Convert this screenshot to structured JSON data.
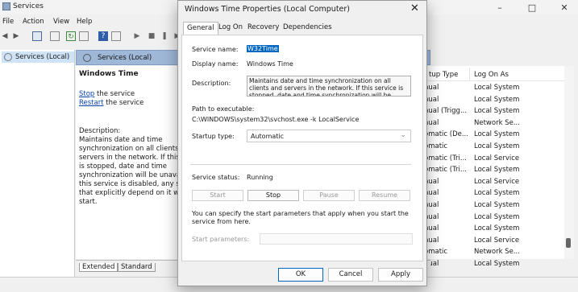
{
  "main": {
    "title": "Services",
    "menu": [
      "File",
      "Action",
      "View",
      "Help"
    ],
    "tree_item": "Services (Local)",
    "panel_header": "Services (Local)",
    "service_heading": "Windows Time",
    "stop_link": "Stop",
    "stop_suffix": " the service",
    "restart_link": "Restart",
    "restart_suffix": " the service",
    "description_label": "Description:",
    "description_lines": [
      "Maintains date and time",
      "synchronization on all clients a",
      "servers in the network. If this s",
      "is stopped, date and time",
      "synchronization will be unavai",
      "this service is disabled, any ser",
      "that explicitly depend on it wil",
      "start."
    ],
    "columns": {
      "startup_type": "tup Type",
      "log_on_as": "Log On As"
    },
    "rows": [
      [
        "nual",
        "Local System"
      ],
      [
        "nual",
        "Local System"
      ],
      [
        "nual (Trigg...",
        "Local System"
      ],
      [
        "nual",
        "Network Se..."
      ],
      [
        "omatic (De...",
        "Local System"
      ],
      [
        "omatic",
        "Local System"
      ],
      [
        "omatic (Tri...",
        "Local Service"
      ],
      [
        "omatic (Tri...",
        "Local System"
      ],
      [
        "nual",
        "Local Service"
      ],
      [
        "nual",
        "Local System"
      ],
      [
        "nual",
        "Local System"
      ],
      [
        "nual",
        "Local System"
      ],
      [
        "nual",
        "Local System"
      ],
      [
        "nual",
        "Local Service"
      ],
      [
        "omatic",
        "Network Se..."
      ],
      [
        "nual",
        "Local System"
      ]
    ],
    "bottom_tabs": [
      "Extended",
      "Standard"
    ]
  },
  "dialog": {
    "title": "Windows Time Properties (Local Computer)",
    "tabs": [
      "General",
      "Log On",
      "Recovery",
      "Dependencies"
    ],
    "service_name_label": "Service name:",
    "service_name": "W32Time",
    "display_name_label": "Display name:",
    "display_name": "Windows Time",
    "description_label": "Description:",
    "description": "Maintains date and time synchronization on all clients and servers in the network. If this service is stopped, date and time synchronization will be unavailable. If",
    "path_label": "Path to executable:",
    "path": "C:\\WINDOWS\\system32\\svchost.exe -k LocalService",
    "startup_label": "Startup type:",
    "startup_value": "Automatic",
    "status_label": "Service status:",
    "status_value": "Running",
    "buttons": {
      "start": "Start",
      "stop": "Stop",
      "pause": "Pause",
      "resume": "Resume"
    },
    "hint": "You can specify the start parameters that apply when you start the service from here.",
    "params_label": "Start parameters:",
    "ok": "OK",
    "cancel": "Cancel",
    "apply": "Apply"
  }
}
